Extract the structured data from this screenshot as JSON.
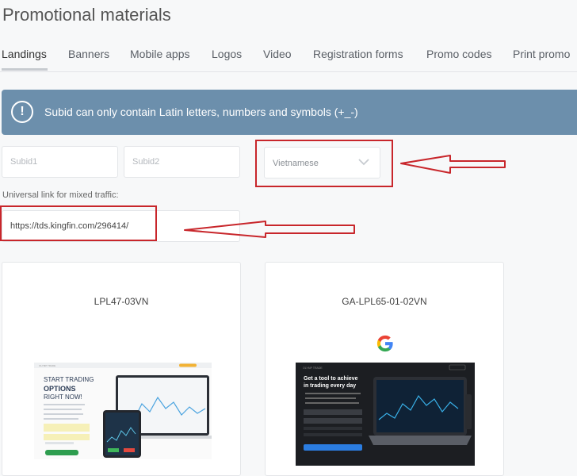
{
  "page": {
    "title": "Promotional materials"
  },
  "tabs": [
    {
      "label": "Landings",
      "active": true
    },
    {
      "label": "Banners"
    },
    {
      "label": "Mobile apps"
    },
    {
      "label": "Logos"
    },
    {
      "label": "Video"
    },
    {
      "label": "Registration forms"
    },
    {
      "label": "Promo codes"
    },
    {
      "label": "Print promo"
    }
  ],
  "notice": {
    "icon": "exclamation-circle-icon",
    "text": "Subid can only contain Latin letters, numbers and symbols (+_-)"
  },
  "form": {
    "subid1_placeholder": "Subid1",
    "subid2_placeholder": "Subid2",
    "language_value": "Vietnamese",
    "universal_link_label": "Universal link for mixed traffic:",
    "universal_link_value": "https://tds.kingfin.com/296414/"
  },
  "cards": [
    {
      "name": "LPL47-03VN",
      "preview": {
        "heading_line1": "START TRADING",
        "heading_line2": "OPTIONS",
        "heading_line3": "RIGHT NOW!"
      }
    },
    {
      "name": "GA-LPL65-01-02VN",
      "badge_icon": "google-icon",
      "preview": {
        "heading_line1": "Get a tool to achieve",
        "heading_line2": "in trading every day"
      }
    }
  ],
  "colors": {
    "notice_bg": "#6c8fac",
    "annotation_red": "#c8262b"
  }
}
